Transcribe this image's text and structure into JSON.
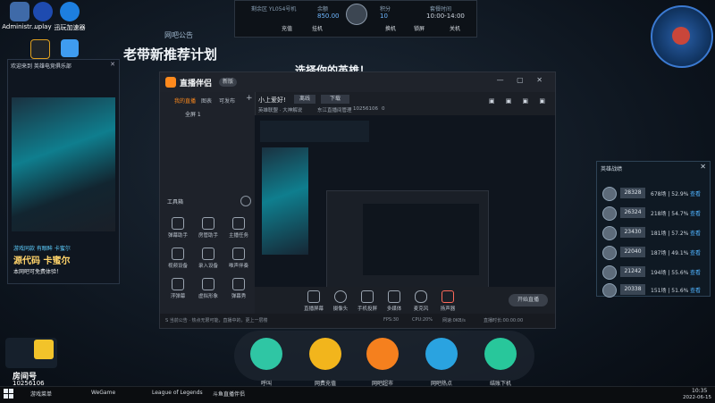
{
  "desktop": {
    "icons": [
      {
        "label": "Administr..."
      },
      {
        "label": "uplay"
      },
      {
        "label": "迅玩加速器"
      }
    ],
    "promo_title": "老带新推荐计划",
    "promo_header": "网吧公告",
    "choose_hero": "选择你的英雄！",
    "promo_panel_title": "欢迎来到 英雄电竞俱乐部",
    "promo_hero_line": "游戏同款 有眼眸 卡蜜尔",
    "promo_code": "源代码 卡蜜尔",
    "promo_note": "本网吧可免费体验！",
    "room_label": "房间号",
    "room_number": "10256106"
  },
  "topbar": {
    "seat": "剩余区 YL054号机",
    "balance_label": "余额",
    "balance": "850.00",
    "points_label": "积分",
    "points": "10",
    "package_label": "套餐时间",
    "package_time": "10:00-14:00",
    "buttons": [
      "充值",
      "挂机",
      "换机",
      "锁屏",
      "关机"
    ]
  },
  "rank_panel": {
    "title": "英雄战绩",
    "rows": [
      {
        "points": "28328",
        "stat": "678场 | 52.9%",
        "action": "查看"
      },
      {
        "points": "26324",
        "stat": "218场 | 54.7%",
        "action": "查看"
      },
      {
        "points": "23430",
        "stat": "181场 | 57.2%",
        "action": "查看"
      },
      {
        "points": "22040",
        "stat": "187场 | 49.1%",
        "action": "查看"
      },
      {
        "points": "21242",
        "stat": "194场 | 55.6%",
        "action": "查看"
      },
      {
        "points": "20338",
        "stat": "151场 | 51.6%",
        "action": "查看"
      }
    ]
  },
  "app": {
    "name": "直播伴侣",
    "badge": "新版",
    "tabs": [
      "我的直播",
      "图表",
      "可发布"
    ],
    "scene": "全屏 1",
    "greeting": "小上爱好!",
    "status_chip": "离线",
    "download_chip": "下载",
    "room_info": "英雄联盟 · 大神解说",
    "room_owner": "东江直播间管理",
    "room_id": "10256106",
    "like_count": "0",
    "tools_title": "工具箱",
    "tools": [
      {
        "label": "弹幕助手"
      },
      {
        "label": "房管助手"
      },
      {
        "label": "主播任务"
      },
      {
        "label": "视频设备"
      },
      {
        "label": "录入设备"
      },
      {
        "label": "唯声伴奏"
      },
      {
        "label": "浮弹幕"
      },
      {
        "label": "虚拟形象"
      },
      {
        "label": "弹幕秀"
      }
    ],
    "bottom_tools": [
      {
        "label": "直播屏幕"
      },
      {
        "label": "摄像头"
      },
      {
        "label": "手机投屏"
      },
      {
        "label": "多媒体"
      },
      {
        "label": "麦克风"
      },
      {
        "label": "扬声器"
      }
    ],
    "start_button": "开始直播",
    "status_text": "S 当前公告 · 热点无限可能，直播中的，更上一层楼",
    "status_values": [
      "FPS:30",
      "CPU:20%",
      "网速:0KB/s",
      "直播时长:00:00:00"
    ]
  },
  "dock": {
    "buttons": [
      {
        "label": "呼叫",
        "icon": "bell-icon",
        "color": "#2fc6a4"
      },
      {
        "label": "网费充值",
        "icon": "coin-icon",
        "color": "#f2b51c"
      },
      {
        "label": "网吧超市",
        "icon": "cart-icon",
        "color": "#f5801e"
      },
      {
        "label": "网吧热点",
        "icon": "clock-icon",
        "color": "#2aa3e0"
      },
      {
        "label": "结账下机",
        "icon": "exit-icon",
        "color": "#28c79b"
      }
    ]
  },
  "taskbar": {
    "items": [
      {
        "label": "游戏菜单"
      },
      {
        "label": "WeGame"
      },
      {
        "label": "League of Legends"
      },
      {
        "label": "斗鱼直播伴侣"
      }
    ],
    "time": "10:35",
    "date": "2022-06-15"
  }
}
